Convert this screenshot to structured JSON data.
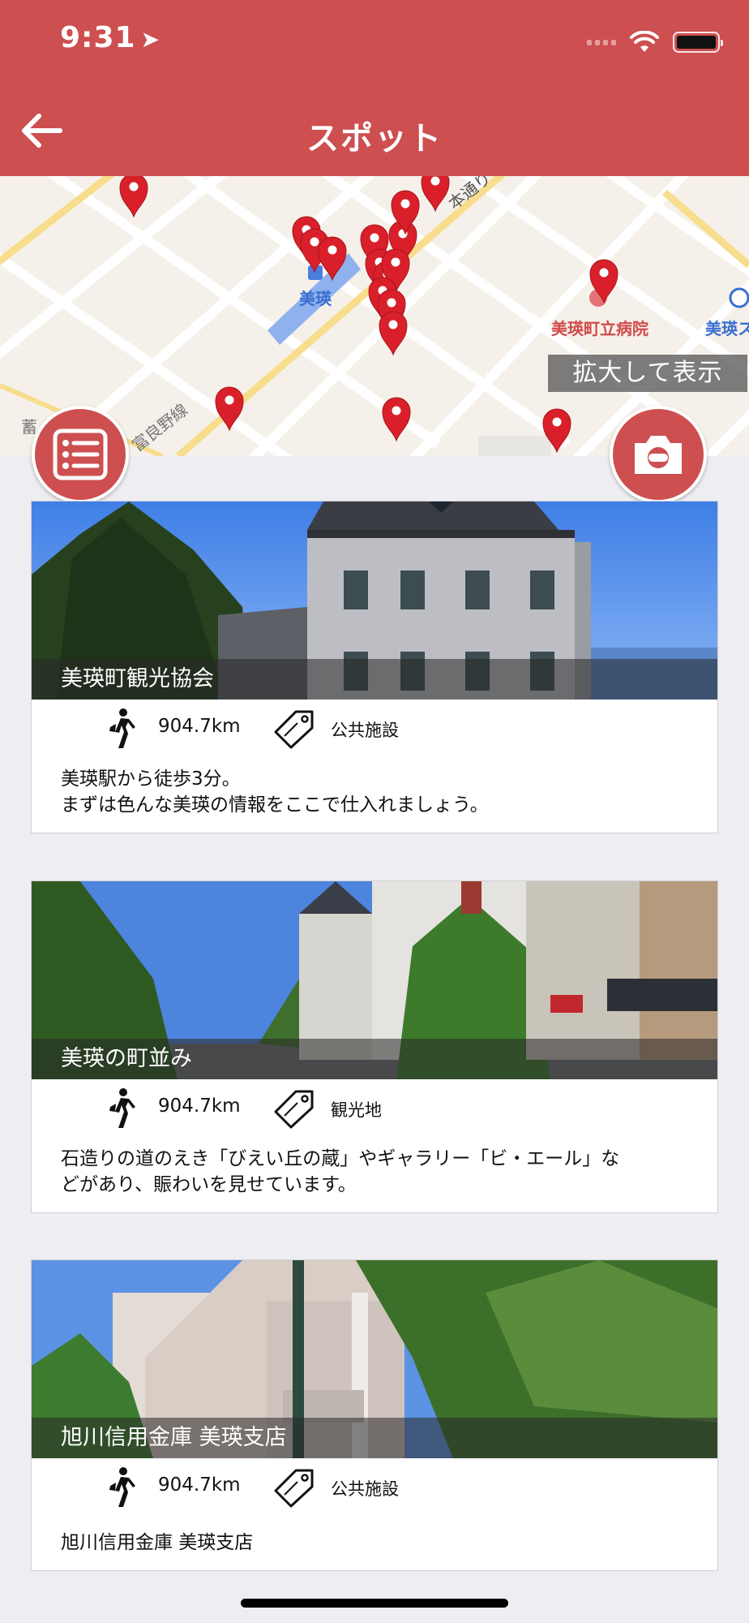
{
  "status_bar": {
    "time": "9:31"
  },
  "header": {
    "title": "スポット"
  },
  "map": {
    "zoom_label": "拡大して表示",
    "labels": {
      "station": "美瑛",
      "street": "本通り",
      "railway": "富良野線",
      "hospital": "美瑛町立病院",
      "partial_right": "美瑛ス",
      "partial_left": "蓄"
    }
  },
  "spots": [
    {
      "name": "美瑛町観光協会",
      "distance": "904.7km",
      "category": "公共施設",
      "description_lines": [
        "美瑛駅から徒歩3分。",
        "まずは色んな美瑛の情報をここで仕入れましょう。"
      ]
    },
    {
      "name": "美瑛の町並み",
      "distance": "904.7km",
      "category": "観光地",
      "description_lines": [
        "石造りの道のえき「びえい丘の蔵」やギャラリー「ビ・エール」な",
        "どがあり、賑わいを見せています。"
      ]
    },
    {
      "name": "旭川信用金庫 美瑛支店",
      "distance": "904.7km",
      "category": "公共施設",
      "description_lines": [
        "旭川信用金庫 美瑛支店"
      ]
    }
  ],
  "colors": {
    "brand": "#cd4f50",
    "pin": "#d9202a"
  },
  "icons": [
    "back-arrow-icon",
    "wifi-icon",
    "battery-icon",
    "list-icon",
    "camera-icon",
    "walk-icon",
    "tag-icon",
    "pin-icon"
  ]
}
